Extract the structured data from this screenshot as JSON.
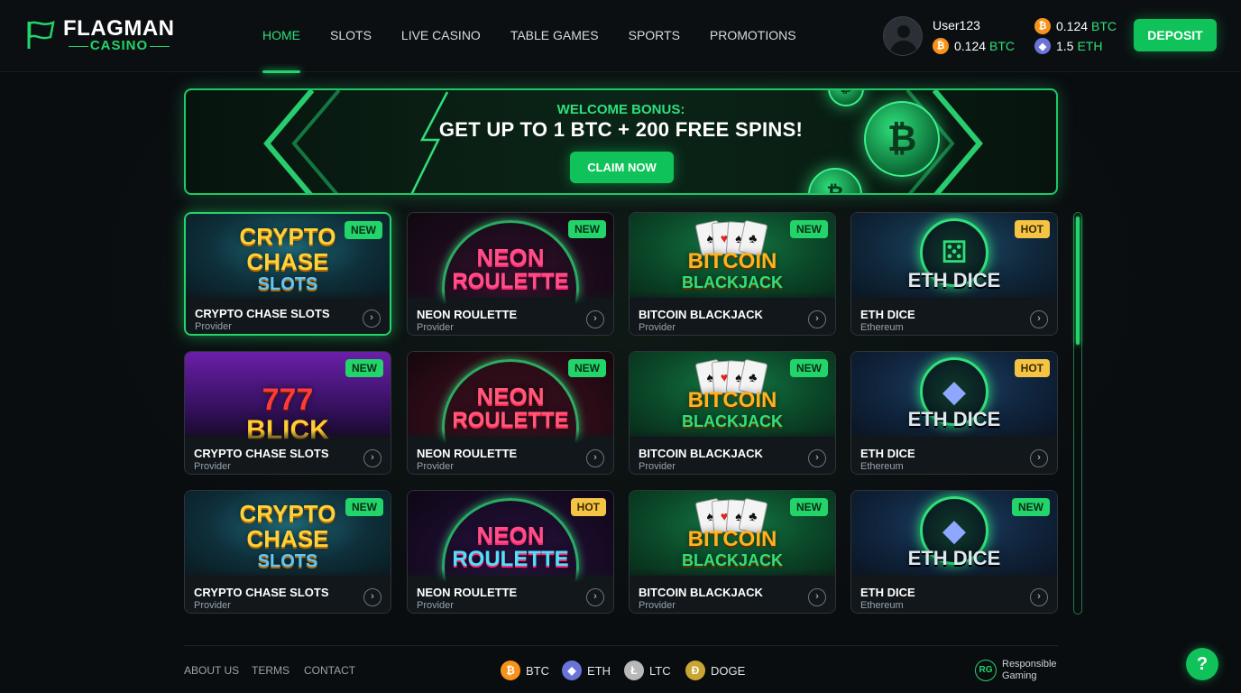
{
  "brand": {
    "name": "FLAGMAN",
    "sub": "CASINO"
  },
  "nav": [
    {
      "label": "HOME",
      "active": true
    },
    {
      "label": "SLOTS"
    },
    {
      "label": "LIVE CASINO"
    },
    {
      "label": "TABLE GAMES"
    },
    {
      "label": "SPORTS"
    },
    {
      "label": "PROMOTIONS"
    }
  ],
  "user": {
    "name": "User123",
    "balance": {
      "amount": "0.124",
      "unit": "BTC"
    }
  },
  "wallet": [
    {
      "amount": "0.124",
      "unit": "BTC",
      "icon": "bitcoin-icon"
    },
    {
      "amount": "1.5",
      "unit": "ETH",
      "icon": "ethereum-icon"
    }
  ],
  "deposit_label": "DEPOSIT",
  "banner": {
    "subtitle": "WELCOME BONUS:",
    "title": "GET UP TO 1 BTC + 200 FREE SPINS!",
    "cta": "CLAIM NOW"
  },
  "games": [
    {
      "art": [
        "CRYPTO",
        "CHASE",
        "SLOTS"
      ],
      "name": "CRYPTO CHASE SLOTS",
      "provider": "Provider",
      "badge": "NEW",
      "theme": "crypto",
      "selected": true
    },
    {
      "art": [
        "NEON",
        "ROULETTE"
      ],
      "name": "NEON ROULETTE",
      "provider": "Provider",
      "badge": "NEW",
      "theme": "neon"
    },
    {
      "art": [
        "BITCOIN",
        "BLACKJACK"
      ],
      "name": "BITCOIN BLACKJACK",
      "provider": "Provider",
      "badge": "NEW",
      "theme": "bj"
    },
    {
      "art": [
        "ETH DICE"
      ],
      "name": "ETH DICE",
      "provider": "Ethereum",
      "badge": "HOT",
      "theme": "dice"
    },
    {
      "art": [
        "777",
        "BLICK"
      ],
      "name": "CRYPTO CHASE SLOTS",
      "provider": "Provider",
      "badge": "NEW",
      "theme": "777"
    },
    {
      "art": [
        "NEON",
        "ROULETTE"
      ],
      "name": "NEON ROULETTE",
      "provider": "Provider",
      "badge": "NEW",
      "theme": "neon2"
    },
    {
      "art": [
        "BITCOIN",
        "BLACKJACK"
      ],
      "name": "BITCOIN BLACKJACK",
      "provider": "Provider",
      "badge": "NEW",
      "theme": "bj"
    },
    {
      "art": [
        "ETH DICE"
      ],
      "name": "ETH DICE",
      "provider": "Ethereum",
      "badge": "HOT",
      "theme": "eth"
    },
    {
      "art": [
        "CRYPTO",
        "CHASE",
        "SLOTS"
      ],
      "name": "CRYPTO CHASE SLOTS",
      "provider": "Provider",
      "badge": "NEW",
      "theme": "crypto"
    },
    {
      "art": [
        "NEON",
        "ROULETTE"
      ],
      "name": "NEON ROULETTE",
      "provider": "Provider",
      "badge": "HOT",
      "theme": "neon3"
    },
    {
      "art": [
        "BITCOIN",
        "BLACKJACK"
      ],
      "name": "BITCOIN BLACKJACK",
      "provider": "Provider",
      "badge": "NEW",
      "theme": "bj"
    },
    {
      "art": [
        "ETH DICE"
      ],
      "name": "ETH DICE",
      "provider": "Ethereum",
      "badge": "NEW",
      "theme": "eth"
    }
  ],
  "footer": {
    "links": [
      "ABOUT US",
      "TERMS",
      "CONTACT"
    ],
    "coins": [
      {
        "symbol": "₿",
        "label": "BTC",
        "cls": "btc"
      },
      {
        "symbol": "◆",
        "label": "ETH",
        "cls": "eth"
      },
      {
        "symbol": "Ł",
        "label": "LTC",
        "cls": "ltc"
      },
      {
        "symbol": "Ð",
        "label": "DOGE",
        "cls": "doge"
      }
    ],
    "rg_badge": "RG",
    "rg_text": "Responsible Gaming",
    "help": "?"
  },
  "colors": {
    "accent": "#22d46a",
    "hot": "#f5c445",
    "btc": "#f7931a",
    "eth": "#6a74d8"
  }
}
